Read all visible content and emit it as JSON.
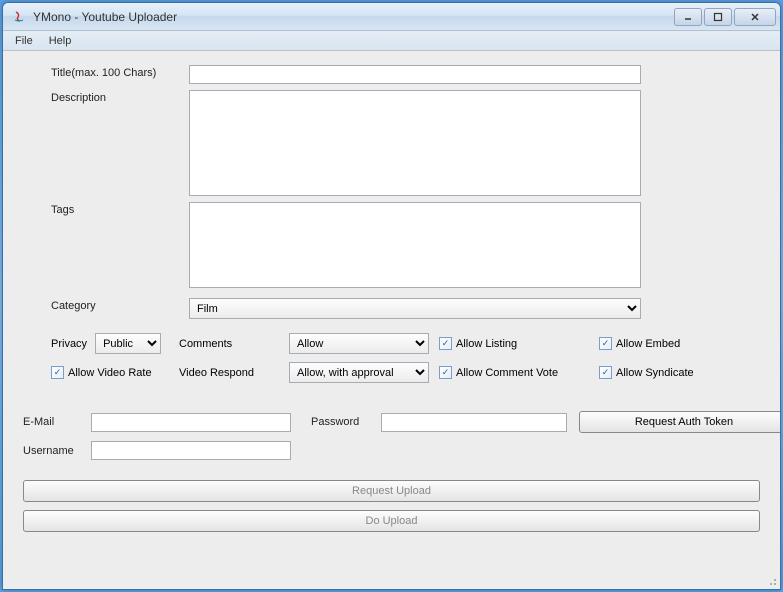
{
  "window": {
    "title": "YMono - Youtube Uploader"
  },
  "menu": {
    "file": "File",
    "help": "Help"
  },
  "labels": {
    "title": "Title(max. 100 Chars)",
    "description": "Description",
    "tags": "Tags",
    "category": "Category",
    "privacy": "Privacy",
    "comments": "Comments",
    "videoRespond": "Video Respond",
    "allowVideoRate": "Allow Video Rate",
    "allowListing": "Allow Listing",
    "allowCommentVote": "Allow Comment Vote",
    "allowEmbed": "Allow Embed",
    "allowSyndicate": "Allow Syndicate",
    "email": "E-Mail",
    "password": "Password",
    "username": "Username"
  },
  "values": {
    "title": "",
    "description": "",
    "tags": "",
    "category": "Film",
    "privacy": "Public",
    "comments": "Allow",
    "videoRespond": "Allow, with approval",
    "email": "",
    "password": "",
    "username": ""
  },
  "checkboxes": {
    "allowVideoRate": true,
    "allowListing": true,
    "allowCommentVote": true,
    "allowEmbed": true,
    "allowSyndicate": true
  },
  "buttons": {
    "requestAuth": "Request Auth Token",
    "requestUpload": "Request Upload",
    "doUpload": "Do Upload"
  }
}
